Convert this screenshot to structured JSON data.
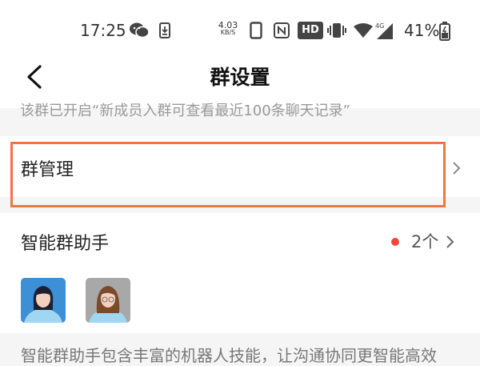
{
  "status_bar": {
    "time": "17:25",
    "net_speed_value": "4.03",
    "net_speed_unit": "KB/S",
    "hd_badge": "HD",
    "signal_label": "4G",
    "battery_percent": "41%",
    "icons": [
      "wechat-icon",
      "download-icon",
      "phone-icon",
      "nfc-icon",
      "vibrate-icon",
      "wifi-icon",
      "signal-icon",
      "battery-icon"
    ]
  },
  "nav": {
    "title": "群设置",
    "back_icon": "back-arrow-icon"
  },
  "info": {
    "text": "该群已开启“新成员入群可查看最近100条聊天记录”"
  },
  "group_manage": {
    "label": "群管理",
    "chevron_icon": "chevron-right-icon"
  },
  "assistant": {
    "label": "智能群助手",
    "count": "2个",
    "badge_color": "#f2453d",
    "avatars": [
      "assistant-avatar-1",
      "assistant-avatar-2"
    ]
  },
  "description": {
    "text": "智能群助手包含丰富的机器人技能，让沟通协同更智能高效"
  },
  "colors": {
    "highlight": "#f07545",
    "background": "#f5f5f5"
  }
}
